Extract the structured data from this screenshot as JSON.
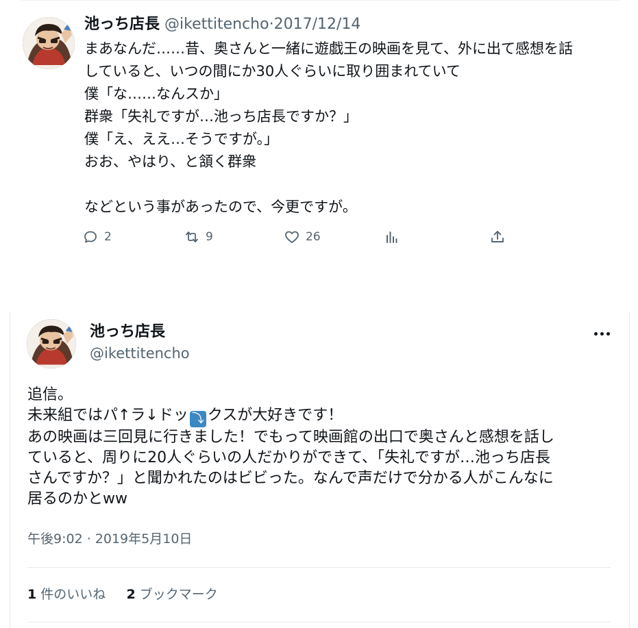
{
  "tweet1": {
    "name": "池っち店長",
    "handle": "@ikettitencho",
    "separator": "·",
    "date": "2017/12/14",
    "lines": [
      "まあなんだ……昔、奥さんと一緒に遊戯王の映画を見て、外に出て感想を話",
      "していると、いつの間にか30人ぐらいに取り囲まれていて",
      "僕「な……なんスか」",
      "群衆「失礼ですが…池っち店長ですか？」",
      "僕「え、ええ…そうですが。」",
      "おお、やはり、と頷く群衆",
      "",
      "などという事があったので、今更ですが。"
    ],
    "actions": {
      "reply_icon": "reply-icon",
      "reply_count": "2",
      "retweet_icon": "retweet-icon",
      "retweet_count": "9",
      "like_icon": "heart-icon",
      "like_count": "26",
      "views_icon": "analytics-icon",
      "share_icon": "share-icon"
    }
  },
  "tweet2": {
    "name": "池っち店長",
    "handle": "@ikettitencho",
    "more_icon": "more-icon",
    "lines": [
      "追信。",
      "未来組ではパ↑ラ↓ドッ⤵️クスが大好きです！",
      "あの映画は三回見に行きました！でもって映画館の出口で奥さんと感想を話し",
      "ていると、周りに20人ぐらいの人だかりができて、「失礼ですが…池っち店長",
      "さんですか？」と聞かれたのはビビった。なんで声だけで分かる人がこんなに",
      "居るのかとww"
    ],
    "line2_parts": [
      "未来組ではパ↑ラ↓ドッ",
      "⤵",
      "クスが大好きです！"
    ],
    "timestamp": "午後9:02 · 2019年5月10日",
    "likes_count": "1",
    "likes_label": "件のいいね",
    "bookmarks_count": "2",
    "bookmarks_label": "ブックマーク"
  },
  "colors": {
    "text": "#0f1419",
    "secondary": "#536471",
    "divider": "#e7e9ea",
    "emoji_blue": "#3b88c3"
  }
}
